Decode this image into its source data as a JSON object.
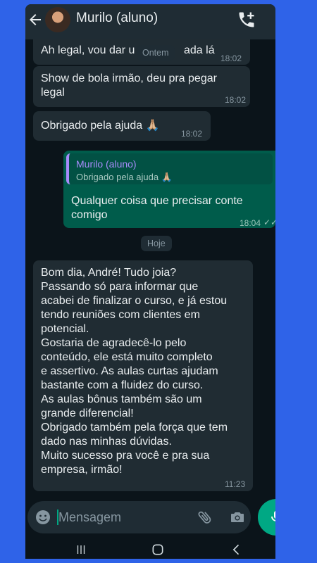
{
  "header": {
    "contact_name": "Murilo (aluno)",
    "back_icon": "arrow-left-icon",
    "avatar_icon": "avatar",
    "action_icon": "add-call-icon"
  },
  "messages": [
    {
      "text": "Ah legal, vou dar u",
      "text_tail": "ada lá",
      "time": "18:02"
    },
    {
      "text": "Show de bola irmão, deu pra pegar legal",
      "time": "18:02"
    },
    {
      "text": "Obrigado pela ajuda 🙏🏼",
      "time": "18:02"
    },
    {
      "quote_name": "Murilo (aluno)",
      "quote_text": "Obrigado pela ajuda 🙏🏼",
      "text": "Qualquer coisa que precisar conte comigo",
      "time": "18:04",
      "status": "✓✓"
    },
    {
      "lines": [
        "Bom dia, André! Tudo joia?",
        "Passando só para informar que",
        "acabei de finalizar o curso, e já estou",
        "tendo reuniões com clientes em",
        "potencial.",
        "Gostaria de agradecê-lo pelo",
        "conteúdo, ele está muito completo",
        "e assertivo. As aulas curtas ajudam",
        "bastante com a fluidez do curso.",
        "As aulas bônus também são um",
        "grande diferencial!",
        "Obrigado também pela força que tem",
        "dado nas minhas dúvidas.",
        "Muito sucesso pra você e pra sua",
        "empresa, irmão!"
      ],
      "time": "11:23"
    }
  ],
  "date_pills": {
    "ontem": "Ontem",
    "hoje": "Hoje"
  },
  "composer": {
    "placeholder": "Mensagem",
    "emoji_icon": "emoji-icon",
    "attach_icon": "paperclip-icon",
    "camera_icon": "camera-icon",
    "mic_icon": "mic-icon"
  },
  "navbar": {
    "recent_icon": "recent-apps-icon",
    "home_icon": "home-icon",
    "back_icon": "nav-back-icon"
  },
  "colors": {
    "accent": "#00a884",
    "incoming": "#202c33",
    "outgoing": "#005c4b",
    "background": "#2f63e8"
  }
}
